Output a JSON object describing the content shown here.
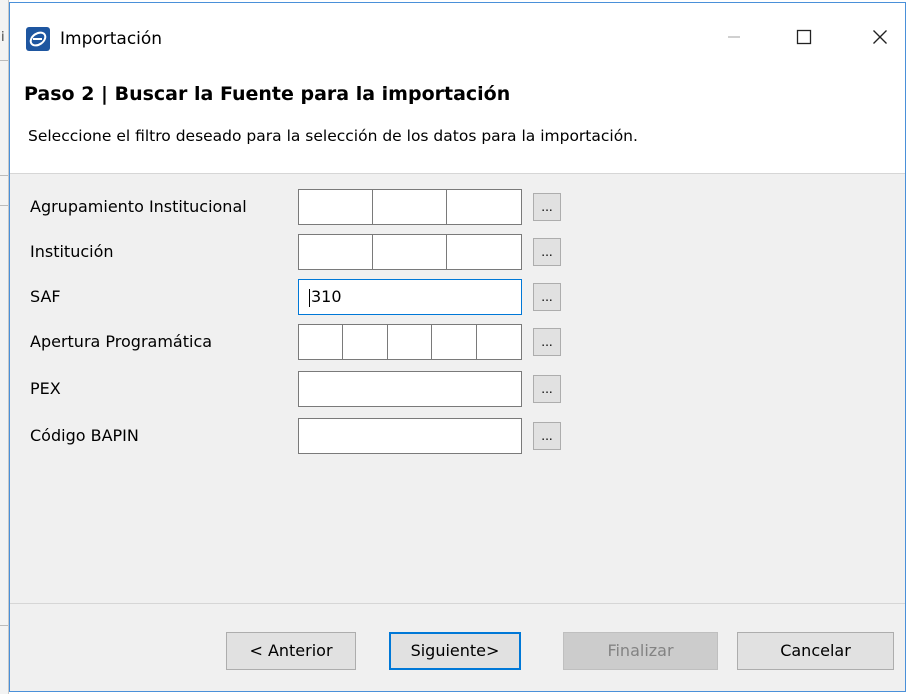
{
  "background_fragment": "i",
  "window": {
    "title": "Importación",
    "icon": "app-e-icon",
    "controls": {
      "minimize": "minimize-icon",
      "maximize": "maximize-icon",
      "close": "close-icon"
    }
  },
  "header": {
    "step_title": "Paso 2 | Buscar la Fuente para la importación",
    "description": "Seleccione el filtro deseado para la selección de los datos para la importación."
  },
  "form": {
    "browse_label": "...",
    "fields": [
      {
        "label": "Agrupamiento Institucional",
        "type": "segmented",
        "segments": [
          "",
          "",
          ""
        ]
      },
      {
        "label": "Institución",
        "type": "segmented",
        "segments": [
          "",
          "",
          ""
        ]
      },
      {
        "label": "SAF",
        "type": "text",
        "value": "310"
      },
      {
        "label": "Apertura Programática",
        "type": "segmented",
        "segments": [
          "",
          "",
          "",
          "",
          ""
        ]
      },
      {
        "label": "PEX",
        "type": "text",
        "value": ""
      },
      {
        "label": "Código BAPIN",
        "type": "text",
        "value": ""
      }
    ]
  },
  "footer": {
    "back_label": "< Anterior",
    "next_label": "Siguiente>",
    "finish_label": "Finalizar",
    "cancel_label": "Cancelar"
  },
  "colors": {
    "window_border": "#4a90d9",
    "focus_accent": "#0078d7",
    "panel_bg": "#f0f0f0",
    "button_bg": "#e1e1e1",
    "disabled_text": "#838383"
  }
}
